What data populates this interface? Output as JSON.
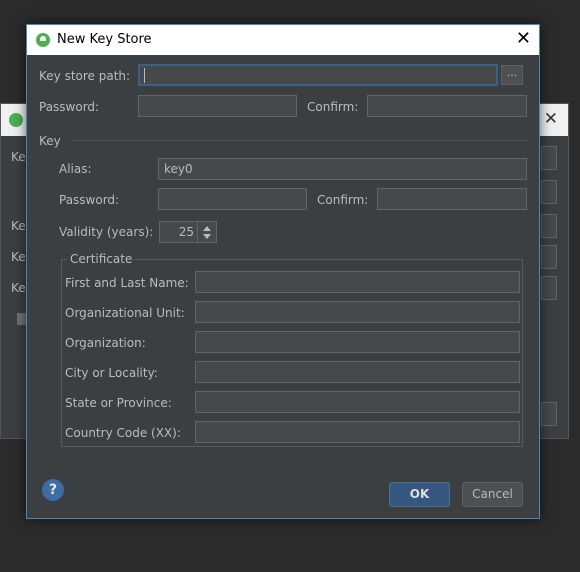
{
  "background_dialog": {
    "labels": [
      "Ke",
      "Ke",
      "Ke",
      "Ke"
    ]
  },
  "dialog": {
    "title": "New Key Store",
    "key_store_path": {
      "label": "Key store path:",
      "value": "",
      "browse_label": "..."
    },
    "password": {
      "label": "Password:",
      "value": ""
    },
    "confirm": {
      "label": "Confirm:",
      "value": ""
    }
  },
  "key": {
    "section_label": "Key",
    "alias": {
      "label": "Alias:",
      "value": "key0"
    },
    "password": {
      "label": "Password:",
      "value": ""
    },
    "confirm": {
      "label": "Confirm:",
      "value": ""
    },
    "validity": {
      "label": "Validity (years):",
      "value": "25"
    }
  },
  "certificate": {
    "legend": "Certificate",
    "fields": [
      {
        "label": "First and Last Name:",
        "value": ""
      },
      {
        "label": "Organizational Unit:",
        "value": ""
      },
      {
        "label": "Organization:",
        "value": ""
      },
      {
        "label": "City or Locality:",
        "value": ""
      },
      {
        "label": "State or Province:",
        "value": ""
      },
      {
        "label": "Country Code (XX):",
        "value": ""
      }
    ]
  },
  "buttons": {
    "help": "?",
    "ok": "OK",
    "cancel": "Cancel"
  },
  "colors": {
    "dialog_bg": "#3c3f41",
    "accent": "#365880",
    "focus_border": "#3d6185"
  }
}
